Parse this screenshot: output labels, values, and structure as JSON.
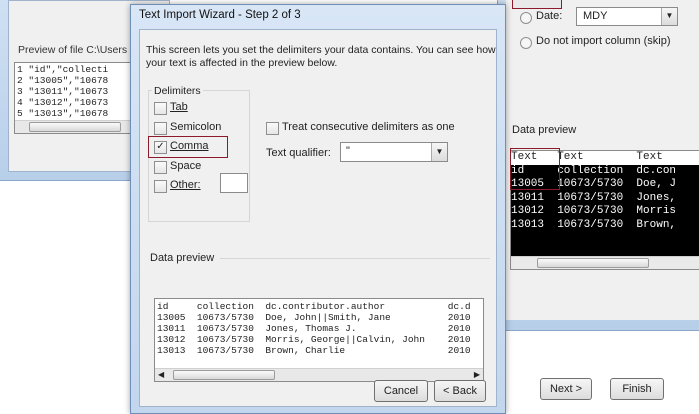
{
  "bg_window": {
    "preview_label": "Preview of file C:\\Users",
    "preview_lines": [
      "1 \"id\",\"collecti",
      "2 \"13005\",\"10678",
      "3 \"13011\",\"10673",
      "4 \"13012\",\"10673",
      "5 \"13013\",\"10678"
    ]
  },
  "right_window": {
    "date_label": "Date:",
    "date_value": "MDY",
    "skip_label": "Do not import column (skip)",
    "data_preview_label": "Data preview",
    "grid_rows": [
      "Text   Text        Text",
      "id     collection  dc.con",
      "13005  10673/5730  Doe, J",
      "13011  10673/5730  Jones,",
      "13012  10673/5730  Morris",
      "13013  10673/5730  Brown,"
    ]
  },
  "dialog": {
    "title": "Text Import Wizard - Step 2 of 3",
    "intro": "This screen lets you set the delimiters your data contains.  You can see how your text is affected in the preview below.",
    "delimiters_label": "Delimiters",
    "tab_label": "Tab",
    "semicolon_label": "Semicolon",
    "comma_label": "Comma",
    "space_label": "Space",
    "other_label": "Other:",
    "treat_consecutive_label": "Treat consecutive delimiters as one",
    "text_qualifier_label": "Text qualifier:",
    "text_qualifier_value": "\"",
    "data_preview_label": "Data preview",
    "preview_rows": [
      "id     collection  dc.contributor.author           dc.d",
      "13005  10673/5730  Doe, John||Smith, Jane          2010",
      "13011  10673/5730  Jones, Thomas J.                2010",
      "13012  10673/5730  Morris, George||Calvin, John    2010",
      "13013  10673/5730  Brown, Charlie                  2010"
    ],
    "buttons": {
      "cancel": "Cancel",
      "back": "< Back",
      "next": "Next >",
      "finish": "Finish"
    }
  },
  "colors": {
    "accent_highlight": "#8c1a2a",
    "title_bar": "#c9dcf2"
  }
}
